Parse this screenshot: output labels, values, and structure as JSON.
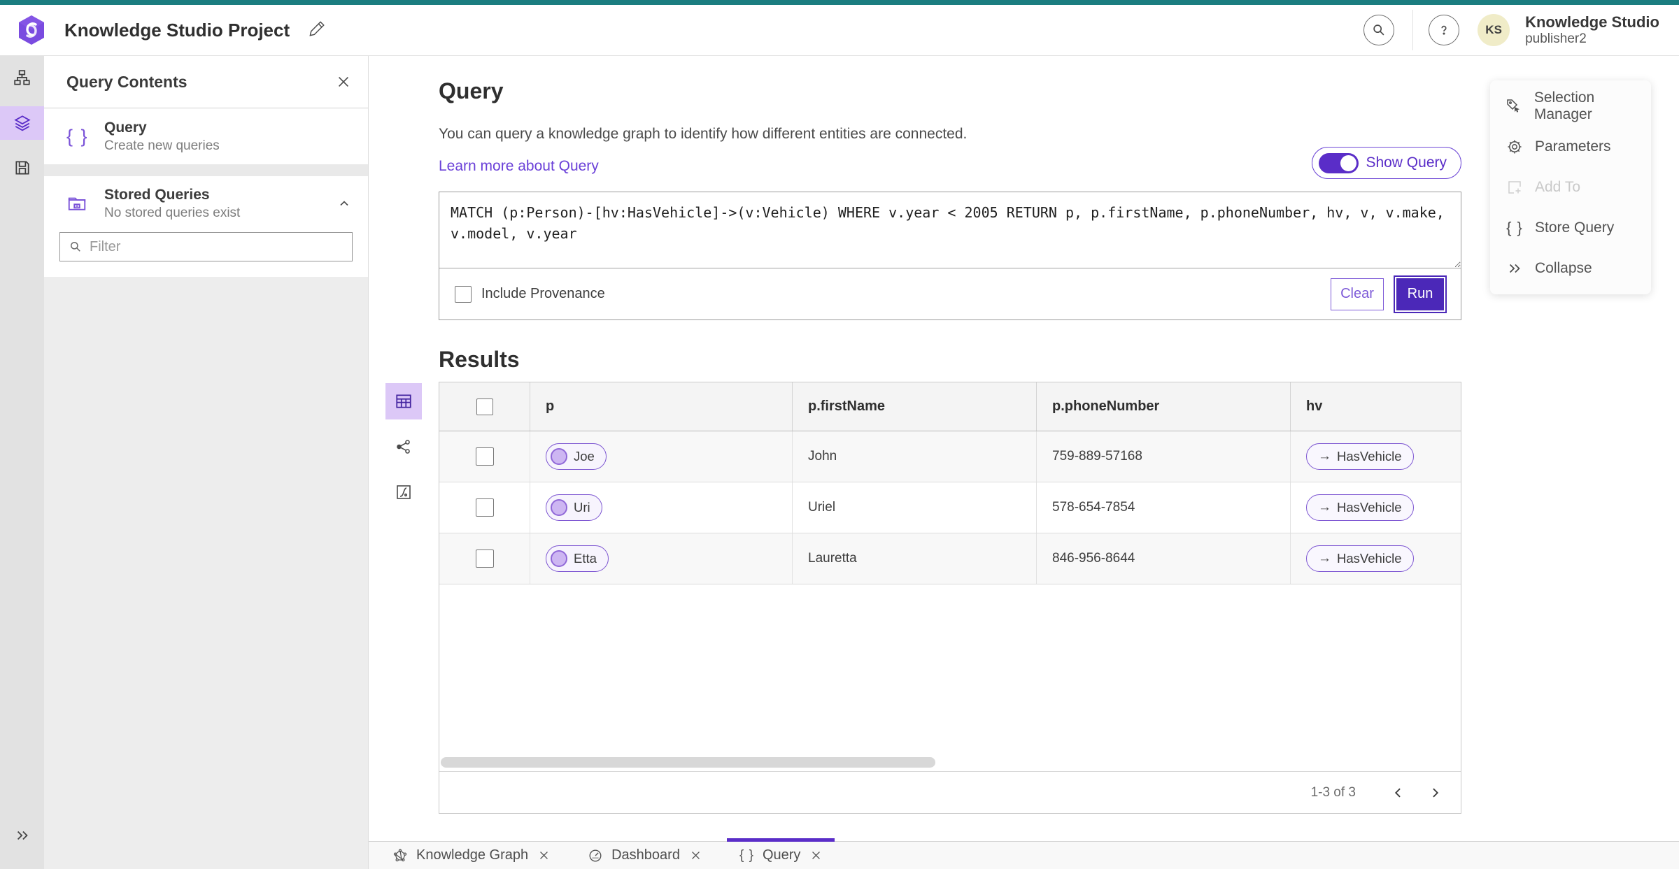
{
  "colors": {
    "accent": "#5a2dc8",
    "accent_dark": "#4b28b8",
    "teal": "#1b7d80",
    "avatar_bg": "#f0ecc8"
  },
  "header": {
    "title": "Knowledge Studio Project",
    "avatar_initials": "KS",
    "user_name": "Knowledge Studio",
    "user_role": "publisher2"
  },
  "sidebar": {
    "panel_title": "Query Contents",
    "query_item": {
      "label": "Query",
      "description": "Create new queries"
    },
    "stored_item": {
      "label": "Stored Queries",
      "description": "No stored queries exist"
    },
    "filter_placeholder": "Filter"
  },
  "query_section": {
    "title": "Query",
    "description": "You can query a knowledge graph to identify how different entities are connected.",
    "learn_more": "Learn more about Query",
    "show_query_label": "Show Query",
    "query_text": "MATCH (p:Person)-[hv:HasVehicle]->(v:Vehicle) WHERE v.year < 2005 RETURN p, p.firstName, p.phoneNumber, hv, v, v.make, v.model, v.year",
    "include_provenance_label": "Include Provenance",
    "clear_label": "Clear",
    "run_label": "Run"
  },
  "results": {
    "title": "Results",
    "columns": [
      "p",
      "p.firstName",
      "p.phoneNumber",
      "hv"
    ],
    "rows": [
      {
        "p": "Joe",
        "firstName": "John",
        "phoneNumber": "759-889-57168",
        "hv": "HasVehicle"
      },
      {
        "p": "Uri",
        "firstName": "Uriel",
        "phoneNumber": "578-654-7854",
        "hv": "HasVehicle"
      },
      {
        "p": "Etta",
        "firstName": "Lauretta",
        "phoneNumber": "846-956-8644",
        "hv": "HasVehicle"
      }
    ],
    "pagination": "1-3 of 3"
  },
  "tools_panel": {
    "items": [
      {
        "label": "Selection Manager",
        "icon_select": true
      },
      {
        "label": "Parameters",
        "icon_gear": true
      },
      {
        "label": "Add To",
        "icon_add": true,
        "disabled": true
      },
      {
        "label": "Store Query",
        "icon_braces": true
      },
      {
        "label": "Collapse",
        "icon_collapse": true
      }
    ]
  },
  "tabs": [
    {
      "label": "Knowledge Graph",
      "icon_kg": true
    },
    {
      "label": "Dashboard",
      "icon_dash": true
    },
    {
      "label": "Query",
      "icon_braces": true,
      "active": true
    }
  ]
}
